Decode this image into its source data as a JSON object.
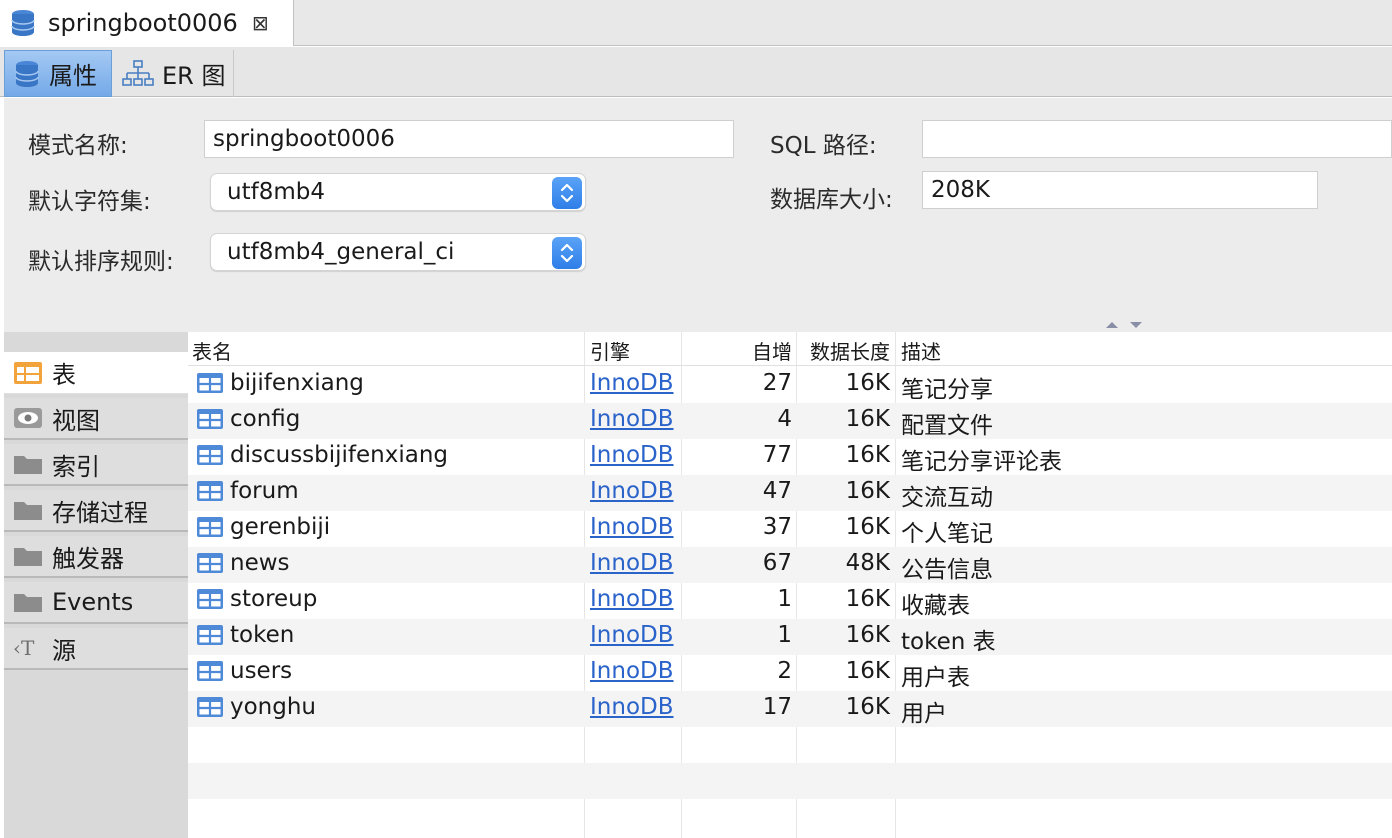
{
  "editor_tab": {
    "title": "springboot0006",
    "close": "⊠"
  },
  "subtabs": {
    "properties": "属性",
    "er": "ER 图"
  },
  "form": {
    "schema_name_label": "模式名称:",
    "schema_name_value": "springboot0006",
    "sql_path_label": "SQL 路径:",
    "sql_path_value": "",
    "charset_label": "默认字符集:",
    "charset_value": "utf8mb4",
    "db_size_label": "数据库大小:",
    "db_size_value": "208K",
    "collation_label": "默认排序规则:",
    "collation_value": "utf8mb4_general_ci"
  },
  "object_nav": [
    {
      "label": "表",
      "icon": "table-icon"
    },
    {
      "label": "视图",
      "icon": "eye-icon"
    },
    {
      "label": "索引",
      "icon": "folder-icon"
    },
    {
      "label": "存储过程",
      "icon": "folder-icon"
    },
    {
      "label": "触发器",
      "icon": "folder-icon"
    },
    {
      "label": "Events",
      "icon": "folder-icon"
    },
    {
      "label": "源",
      "icon": "source-icon"
    }
  ],
  "table_headers": {
    "name": "表名",
    "engine": "引擎",
    "auto_inc": "自增",
    "data_length": "数据长度",
    "comment": "描述"
  },
  "tables": [
    {
      "name": "bijifenxiang",
      "engine": "InnoDB",
      "auto_inc": "27",
      "data_length": "16K",
      "comment": "笔记分享"
    },
    {
      "name": "config",
      "engine": "InnoDB",
      "auto_inc": "4",
      "data_length": "16K",
      "comment": "配置文件"
    },
    {
      "name": "discussbijifenxiang",
      "engine": "InnoDB",
      "auto_inc": "77",
      "data_length": "16K",
      "comment": "笔记分享评论表"
    },
    {
      "name": "forum",
      "engine": "InnoDB",
      "auto_inc": "47",
      "data_length": "16K",
      "comment": "交流互动"
    },
    {
      "name": "gerenbiji",
      "engine": "InnoDB",
      "auto_inc": "37",
      "data_length": "16K",
      "comment": "个人笔记"
    },
    {
      "name": "news",
      "engine": "InnoDB",
      "auto_inc": "67",
      "data_length": "48K",
      "comment": "公告信息"
    },
    {
      "name": "storeup",
      "engine": "InnoDB",
      "auto_inc": "1",
      "data_length": "16K",
      "comment": "收藏表"
    },
    {
      "name": "token",
      "engine": "InnoDB",
      "auto_inc": "1",
      "data_length": "16K",
      "comment": "token 表"
    },
    {
      "name": "users",
      "engine": "InnoDB",
      "auto_inc": "2",
      "data_length": "16K",
      "comment": "用户表"
    },
    {
      "name": "yonghu",
      "engine": "InnoDB",
      "auto_inc": "17",
      "data_length": "16K",
      "comment": "用户"
    }
  ]
}
